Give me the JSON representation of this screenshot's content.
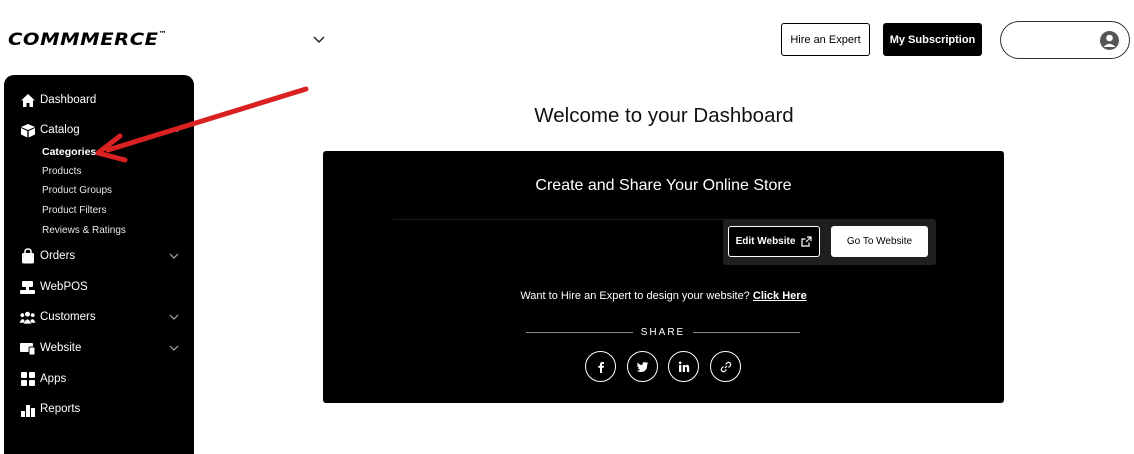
{
  "header": {
    "logo_text": "COMMMERCE",
    "logo_tm": "™",
    "hire_label": "Hire an Expert",
    "subscription_label": "My Subscription"
  },
  "sidebar": {
    "items": [
      {
        "label": "Dashboard",
        "icon": "home-icon"
      },
      {
        "label": "Catalog",
        "icon": "box-icon",
        "expanded": true
      },
      {
        "label": "Orders",
        "icon": "bag-icon"
      },
      {
        "label": "WebPOS",
        "icon": "pos-icon"
      },
      {
        "label": "Customers",
        "icon": "customers-icon"
      },
      {
        "label": "Website",
        "icon": "website-icon"
      },
      {
        "label": "Apps",
        "icon": "apps-icon"
      },
      {
        "label": "Reports",
        "icon": "reports-icon"
      }
    ],
    "catalog_sub": [
      "Categories",
      "Products",
      "Product Groups",
      "Product Filters",
      "Reviews & Ratings"
    ],
    "active_sub": "Categories"
  },
  "main": {
    "title": "Welcome to your Dashboard",
    "card": {
      "title": "Create and Share Your Online Store",
      "edit_label": "Edit Website",
      "go_label": "Go To Website",
      "hire_text": "Want to Hire an Expert to design your website?",
      "hire_link": "Click Here",
      "share_label": "SHARE",
      "social": [
        "facebook-icon",
        "twitter-icon",
        "linkedin-icon",
        "link-icon"
      ]
    }
  },
  "colors": {
    "background": "#ffffff",
    "sidebar": "#000000",
    "card": "#000000",
    "arrow": "#d92121"
  }
}
